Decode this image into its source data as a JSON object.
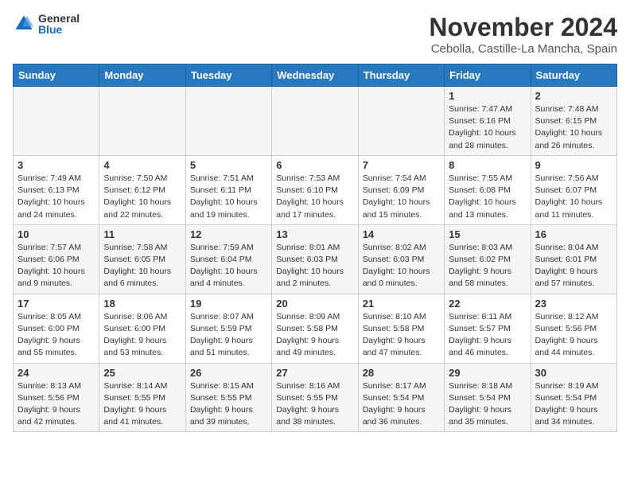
{
  "logo": {
    "general": "General",
    "blue": "Blue"
  },
  "title": "November 2024",
  "location": "Cebolla, Castille-La Mancha, Spain",
  "weekdays": [
    "Sunday",
    "Monday",
    "Tuesday",
    "Wednesday",
    "Thursday",
    "Friday",
    "Saturday"
  ],
  "weeks": [
    [
      {
        "day": "",
        "info": ""
      },
      {
        "day": "",
        "info": ""
      },
      {
        "day": "",
        "info": ""
      },
      {
        "day": "",
        "info": ""
      },
      {
        "day": "",
        "info": ""
      },
      {
        "day": "1",
        "info": "Sunrise: 7:47 AM\nSunset: 6:16 PM\nDaylight: 10 hours and 28 minutes."
      },
      {
        "day": "2",
        "info": "Sunrise: 7:48 AM\nSunset: 6:15 PM\nDaylight: 10 hours and 26 minutes."
      }
    ],
    [
      {
        "day": "3",
        "info": "Sunrise: 7:49 AM\nSunset: 6:13 PM\nDaylight: 10 hours and 24 minutes."
      },
      {
        "day": "4",
        "info": "Sunrise: 7:50 AM\nSunset: 6:12 PM\nDaylight: 10 hours and 22 minutes."
      },
      {
        "day": "5",
        "info": "Sunrise: 7:51 AM\nSunset: 6:11 PM\nDaylight: 10 hours and 19 minutes."
      },
      {
        "day": "6",
        "info": "Sunrise: 7:53 AM\nSunset: 6:10 PM\nDaylight: 10 hours and 17 minutes."
      },
      {
        "day": "7",
        "info": "Sunrise: 7:54 AM\nSunset: 6:09 PM\nDaylight: 10 hours and 15 minutes."
      },
      {
        "day": "8",
        "info": "Sunrise: 7:55 AM\nSunset: 6:08 PM\nDaylight: 10 hours and 13 minutes."
      },
      {
        "day": "9",
        "info": "Sunrise: 7:56 AM\nSunset: 6:07 PM\nDaylight: 10 hours and 11 minutes."
      }
    ],
    [
      {
        "day": "10",
        "info": "Sunrise: 7:57 AM\nSunset: 6:06 PM\nDaylight: 10 hours and 9 minutes."
      },
      {
        "day": "11",
        "info": "Sunrise: 7:58 AM\nSunset: 6:05 PM\nDaylight: 10 hours and 6 minutes."
      },
      {
        "day": "12",
        "info": "Sunrise: 7:59 AM\nSunset: 6:04 PM\nDaylight: 10 hours and 4 minutes."
      },
      {
        "day": "13",
        "info": "Sunrise: 8:01 AM\nSunset: 6:03 PM\nDaylight: 10 hours and 2 minutes."
      },
      {
        "day": "14",
        "info": "Sunrise: 8:02 AM\nSunset: 6:03 PM\nDaylight: 10 hours and 0 minutes."
      },
      {
        "day": "15",
        "info": "Sunrise: 8:03 AM\nSunset: 6:02 PM\nDaylight: 9 hours and 58 minutes."
      },
      {
        "day": "16",
        "info": "Sunrise: 8:04 AM\nSunset: 6:01 PM\nDaylight: 9 hours and 57 minutes."
      }
    ],
    [
      {
        "day": "17",
        "info": "Sunrise: 8:05 AM\nSunset: 6:00 PM\nDaylight: 9 hours and 55 minutes."
      },
      {
        "day": "18",
        "info": "Sunrise: 8:06 AM\nSunset: 6:00 PM\nDaylight: 9 hours and 53 minutes."
      },
      {
        "day": "19",
        "info": "Sunrise: 8:07 AM\nSunset: 5:59 PM\nDaylight: 9 hours and 51 minutes."
      },
      {
        "day": "20",
        "info": "Sunrise: 8:09 AM\nSunset: 5:58 PM\nDaylight: 9 hours and 49 minutes."
      },
      {
        "day": "21",
        "info": "Sunrise: 8:10 AM\nSunset: 5:58 PM\nDaylight: 9 hours and 47 minutes."
      },
      {
        "day": "22",
        "info": "Sunrise: 8:11 AM\nSunset: 5:57 PM\nDaylight: 9 hours and 46 minutes."
      },
      {
        "day": "23",
        "info": "Sunrise: 8:12 AM\nSunset: 5:56 PM\nDaylight: 9 hours and 44 minutes."
      }
    ],
    [
      {
        "day": "24",
        "info": "Sunrise: 8:13 AM\nSunset: 5:56 PM\nDaylight: 9 hours and 42 minutes."
      },
      {
        "day": "25",
        "info": "Sunrise: 8:14 AM\nSunset: 5:55 PM\nDaylight: 9 hours and 41 minutes."
      },
      {
        "day": "26",
        "info": "Sunrise: 8:15 AM\nSunset: 5:55 PM\nDaylight: 9 hours and 39 minutes."
      },
      {
        "day": "27",
        "info": "Sunrise: 8:16 AM\nSunset: 5:55 PM\nDaylight: 9 hours and 38 minutes."
      },
      {
        "day": "28",
        "info": "Sunrise: 8:17 AM\nSunset: 5:54 PM\nDaylight: 9 hours and 36 minutes."
      },
      {
        "day": "29",
        "info": "Sunrise: 8:18 AM\nSunset: 5:54 PM\nDaylight: 9 hours and 35 minutes."
      },
      {
        "day": "30",
        "info": "Sunrise: 8:19 AM\nSunset: 5:54 PM\nDaylight: 9 hours and 34 minutes."
      }
    ]
  ]
}
